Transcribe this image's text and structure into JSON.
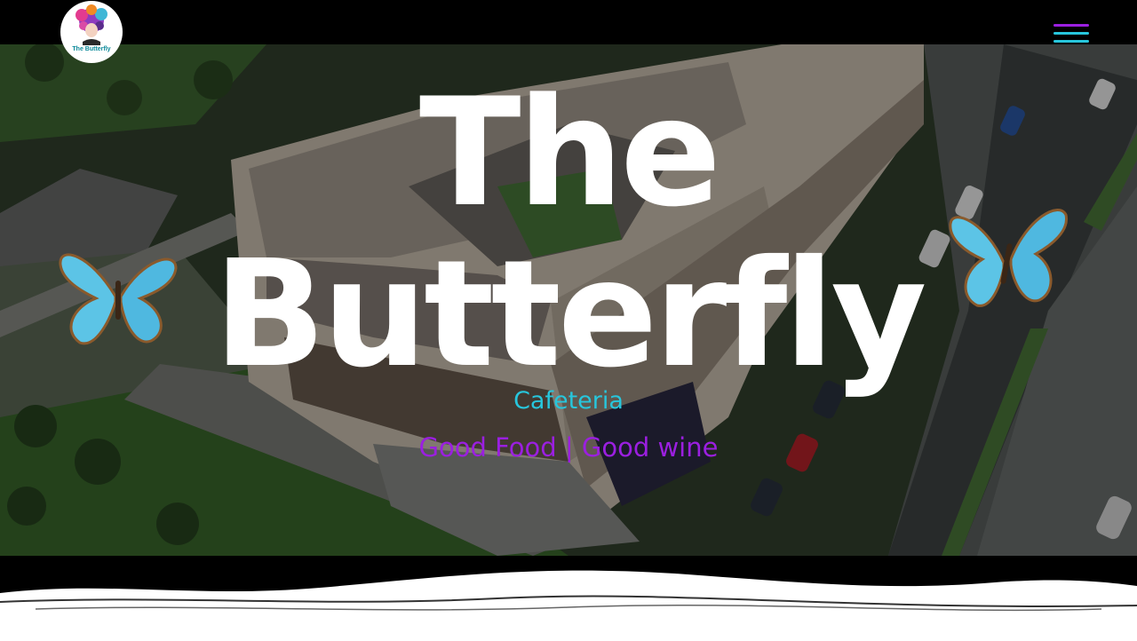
{
  "brand": {
    "logo_text": "The Butterfly",
    "colors": {
      "cyan": "#27c6dc",
      "purple": "#9b1fe0",
      "header": "#000000"
    }
  },
  "header": {
    "menu_icon": "hamburger-menu-icon"
  },
  "hero": {
    "title_line1": "The",
    "title_line2": "Butterfly",
    "subtitle": "Cafeteria",
    "tagline": "Good Food | Good wine",
    "background": "aerial photo of apartment building with cafe terrace"
  }
}
